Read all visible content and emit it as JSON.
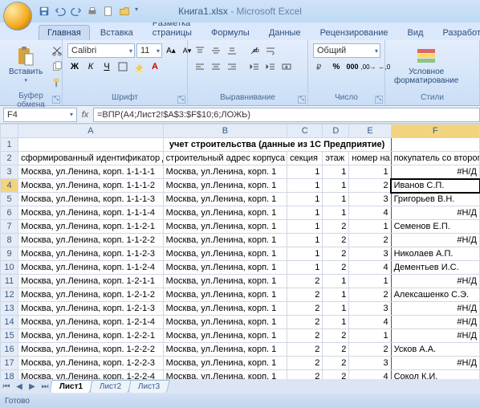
{
  "title": {
    "filename": "Книга1.xlsx",
    "app": "Microsoft Excel"
  },
  "tabs": [
    "Главная",
    "Вставка",
    "Разметка страницы",
    "Формулы",
    "Данные",
    "Рецензирование",
    "Вид",
    "Разработчик"
  ],
  "active_tab": 0,
  "ribbon": {
    "clipboard": {
      "paste": "Вставить",
      "title": "Буфер обмена"
    },
    "font": {
      "name": "Calibri",
      "size": "11",
      "title": "Шрифт"
    },
    "align": {
      "title": "Выравнивание"
    },
    "number": {
      "format": "Общий",
      "title": "Число"
    },
    "styles": {
      "cond": "Условное\nформатирование",
      "title": "Стили"
    }
  },
  "namebox": "F4",
  "formula": "=ВПР(A4;Лист2!$A$3:$F$10;6;ЛОЖЬ)",
  "columns": [
    "A",
    "B",
    "C",
    "D",
    "E",
    "F"
  ],
  "header_merged": "учет строительства (данные из 1С Предприятие)",
  "headers": {
    "A": "сформированный идентификатор для строки",
    "B": "строительный адрес корпуса",
    "C": "секция",
    "D": "этаж",
    "E": "номер на этаже",
    "F": "покупатель со второго листа"
  },
  "rows": [
    {
      "n": 3,
      "A": "Москва, ул.Ленина, корп. 1-1-1-1",
      "B": "Москва, ул.Ленина, корп. 1",
      "C": 1,
      "D": 1,
      "E": 1,
      "F": "#Н/Д"
    },
    {
      "n": 4,
      "A": "Москва, ул.Ленина, корп. 1-1-1-2",
      "B": "Москва, ул.Ленина, корп. 1",
      "C": 1,
      "D": 1,
      "E": 2,
      "F": "Иванов С.П."
    },
    {
      "n": 5,
      "A": "Москва, ул.Ленина, корп. 1-1-1-3",
      "B": "Москва, ул.Ленина, корп. 1",
      "C": 1,
      "D": 1,
      "E": 3,
      "F": "Григорьев В.Н."
    },
    {
      "n": 6,
      "A": "Москва, ул.Ленина, корп. 1-1-1-4",
      "B": "Москва, ул.Ленина, корп. 1",
      "C": 1,
      "D": 1,
      "E": 4,
      "F": "#Н/Д"
    },
    {
      "n": 7,
      "A": "Москва, ул.Ленина, корп. 1-1-2-1",
      "B": "Москва, ул.Ленина, корп. 1",
      "C": 1,
      "D": 2,
      "E": 1,
      "F": "Семенов Е.П."
    },
    {
      "n": 8,
      "A": "Москва, ул.Ленина, корп. 1-1-2-2",
      "B": "Москва, ул.Ленина, корп. 1",
      "C": 1,
      "D": 2,
      "E": 2,
      "F": "#Н/Д"
    },
    {
      "n": 9,
      "A": "Москва, ул.Ленина, корп. 1-1-2-3",
      "B": "Москва, ул.Ленина, корп. 1",
      "C": 1,
      "D": 2,
      "E": 3,
      "F": "Николаев А.П."
    },
    {
      "n": 10,
      "A": "Москва, ул.Ленина, корп. 1-1-2-4",
      "B": "Москва, ул.Ленина, корп. 1",
      "C": 1,
      "D": 2,
      "E": 4,
      "F": "Дементьев И.С."
    },
    {
      "n": 11,
      "A": "Москва, ул.Ленина, корп. 1-2-1-1",
      "B": "Москва, ул.Ленина, корп. 1",
      "C": 2,
      "D": 1,
      "E": 1,
      "F": "#Н/Д"
    },
    {
      "n": 12,
      "A": "Москва, ул.Ленина, корп. 1-2-1-2",
      "B": "Москва, ул.Ленина, корп. 1",
      "C": 2,
      "D": 1,
      "E": 2,
      "F": "Алексашенко С.Э."
    },
    {
      "n": 13,
      "A": "Москва, ул.Ленина, корп. 1-2-1-3",
      "B": "Москва, ул.Ленина, корп. 1",
      "C": 2,
      "D": 1,
      "E": 3,
      "F": "#Н/Д"
    },
    {
      "n": 14,
      "A": "Москва, ул.Ленина, корп. 1-2-1-4",
      "B": "Москва, ул.Ленина, корп. 1",
      "C": 2,
      "D": 1,
      "E": 4,
      "F": "#Н/Д"
    },
    {
      "n": 15,
      "A": "Москва, ул.Ленина, корп. 1-2-2-1",
      "B": "Москва, ул.Ленина, корп. 1",
      "C": 2,
      "D": 2,
      "E": 1,
      "F": "#Н/Д"
    },
    {
      "n": 16,
      "A": "Москва, ул.Ленина, корп. 1-2-2-2",
      "B": "Москва, ул.Ленина, корп. 1",
      "C": 2,
      "D": 2,
      "E": 2,
      "F": "Усков А.А."
    },
    {
      "n": 17,
      "A": "Москва, ул.Ленина, корп. 1-2-2-3",
      "B": "Москва, ул.Ленина, корп. 1",
      "C": 2,
      "D": 2,
      "E": 3,
      "F": "#Н/Д"
    },
    {
      "n": 18,
      "A": "Москва, ул.Ленина, корп. 1-2-2-4",
      "B": "Москва, ул.Ленина, корп. 1",
      "C": 2,
      "D": 2,
      "E": 4,
      "F": "Сокол К.И."
    }
  ],
  "selected_cell": {
    "row": 4,
    "col": "F"
  },
  "sheet_tabs": [
    "Лист1",
    "Лист2",
    "Лист3"
  ],
  "active_sheet": 0,
  "status": "Готово"
}
